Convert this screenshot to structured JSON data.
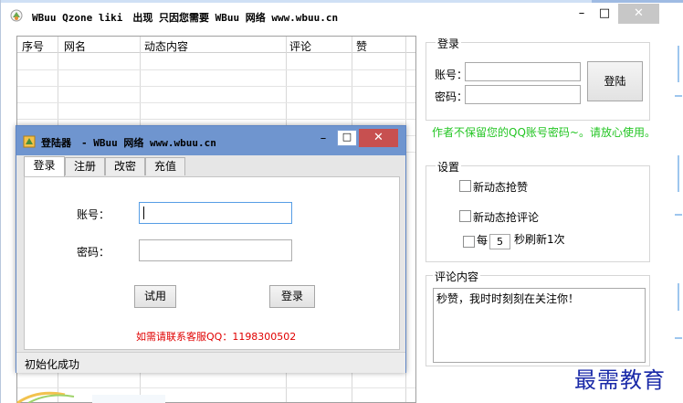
{
  "window": {
    "title": "WBuu Qzone liki　出现 只因您需要 WBuu 网络 www.wbuu.cn",
    "minimize": "–",
    "maximize": "□",
    "close": "✕"
  },
  "table": {
    "columns": [
      "序号",
      "网名",
      "动态内容",
      "评论",
      "赞"
    ],
    "rows": []
  },
  "login_group": {
    "title": "登录",
    "account_label": "账号：",
    "password_label": "密码：",
    "account_value": "",
    "password_value": "",
    "login_button": "登陆",
    "notice": "作者不保留您的QQ账号密码~。请放心使用。"
  },
  "settings_group": {
    "title": "设置",
    "option_new_like": "新动态抢赞",
    "option_new_comment": "新动态抢评论",
    "refresh_prefix": "每",
    "refresh_value": "5",
    "refresh_suffix": "秒刷新1次",
    "new_like_checked": false,
    "new_comment_checked": false,
    "refresh_checked": false
  },
  "comment_group": {
    "title": "评论内容",
    "text": "秒赞，我时时刻刻在关注你！"
  },
  "watermark": "最需教育",
  "dialog": {
    "title": "登陆器　- WBuu 网络 www.wbuu.cn",
    "minimize": "–",
    "maximize": "□",
    "close": "✕",
    "tabs": [
      "登录",
      "注册",
      "改密",
      "充值"
    ],
    "active_tab": "登录",
    "account_label": "账号：",
    "password_label": "密码：",
    "account_value": "",
    "password_value": "",
    "trial_button": "试用",
    "login_button": "登录",
    "contact": "如需请联系客服QQ：1198300502",
    "status": "初始化成功"
  },
  "colors": {
    "notice_green": "#22c522",
    "contact_red": "#e00000",
    "dialog_titlebar": "#6f95cf",
    "close_red": "#c75050",
    "watermark_blue": "#1a2aa8"
  }
}
